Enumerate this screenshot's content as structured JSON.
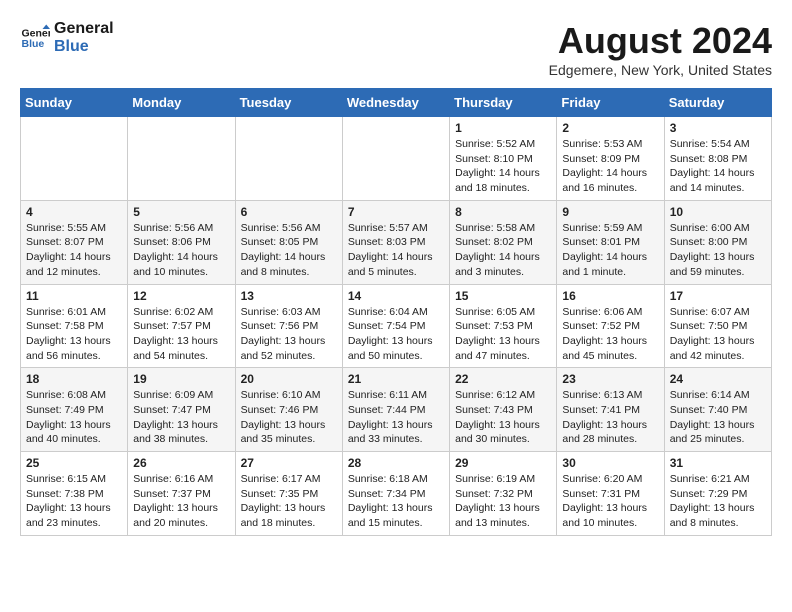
{
  "header": {
    "logo_line1": "General",
    "logo_line2": "Blue",
    "month_year": "August 2024",
    "location": "Edgemere, New York, United States"
  },
  "weekdays": [
    "Sunday",
    "Monday",
    "Tuesday",
    "Wednesday",
    "Thursday",
    "Friday",
    "Saturday"
  ],
  "weeks": [
    [
      {
        "day": "",
        "info": ""
      },
      {
        "day": "",
        "info": ""
      },
      {
        "day": "",
        "info": ""
      },
      {
        "day": "",
        "info": ""
      },
      {
        "day": "1",
        "info": "Sunrise: 5:52 AM\nSunset: 8:10 PM\nDaylight: 14 hours\nand 18 minutes."
      },
      {
        "day": "2",
        "info": "Sunrise: 5:53 AM\nSunset: 8:09 PM\nDaylight: 14 hours\nand 16 minutes."
      },
      {
        "day": "3",
        "info": "Sunrise: 5:54 AM\nSunset: 8:08 PM\nDaylight: 14 hours\nand 14 minutes."
      }
    ],
    [
      {
        "day": "4",
        "info": "Sunrise: 5:55 AM\nSunset: 8:07 PM\nDaylight: 14 hours\nand 12 minutes."
      },
      {
        "day": "5",
        "info": "Sunrise: 5:56 AM\nSunset: 8:06 PM\nDaylight: 14 hours\nand 10 minutes."
      },
      {
        "day": "6",
        "info": "Sunrise: 5:56 AM\nSunset: 8:05 PM\nDaylight: 14 hours\nand 8 minutes."
      },
      {
        "day": "7",
        "info": "Sunrise: 5:57 AM\nSunset: 8:03 PM\nDaylight: 14 hours\nand 5 minutes."
      },
      {
        "day": "8",
        "info": "Sunrise: 5:58 AM\nSunset: 8:02 PM\nDaylight: 14 hours\nand 3 minutes."
      },
      {
        "day": "9",
        "info": "Sunrise: 5:59 AM\nSunset: 8:01 PM\nDaylight: 14 hours\nand 1 minute."
      },
      {
        "day": "10",
        "info": "Sunrise: 6:00 AM\nSunset: 8:00 PM\nDaylight: 13 hours\nand 59 minutes."
      }
    ],
    [
      {
        "day": "11",
        "info": "Sunrise: 6:01 AM\nSunset: 7:58 PM\nDaylight: 13 hours\nand 56 minutes."
      },
      {
        "day": "12",
        "info": "Sunrise: 6:02 AM\nSunset: 7:57 PM\nDaylight: 13 hours\nand 54 minutes."
      },
      {
        "day": "13",
        "info": "Sunrise: 6:03 AM\nSunset: 7:56 PM\nDaylight: 13 hours\nand 52 minutes."
      },
      {
        "day": "14",
        "info": "Sunrise: 6:04 AM\nSunset: 7:54 PM\nDaylight: 13 hours\nand 50 minutes."
      },
      {
        "day": "15",
        "info": "Sunrise: 6:05 AM\nSunset: 7:53 PM\nDaylight: 13 hours\nand 47 minutes."
      },
      {
        "day": "16",
        "info": "Sunrise: 6:06 AM\nSunset: 7:52 PM\nDaylight: 13 hours\nand 45 minutes."
      },
      {
        "day": "17",
        "info": "Sunrise: 6:07 AM\nSunset: 7:50 PM\nDaylight: 13 hours\nand 42 minutes."
      }
    ],
    [
      {
        "day": "18",
        "info": "Sunrise: 6:08 AM\nSunset: 7:49 PM\nDaylight: 13 hours\nand 40 minutes."
      },
      {
        "day": "19",
        "info": "Sunrise: 6:09 AM\nSunset: 7:47 PM\nDaylight: 13 hours\nand 38 minutes."
      },
      {
        "day": "20",
        "info": "Sunrise: 6:10 AM\nSunset: 7:46 PM\nDaylight: 13 hours\nand 35 minutes."
      },
      {
        "day": "21",
        "info": "Sunrise: 6:11 AM\nSunset: 7:44 PM\nDaylight: 13 hours\nand 33 minutes."
      },
      {
        "day": "22",
        "info": "Sunrise: 6:12 AM\nSunset: 7:43 PM\nDaylight: 13 hours\nand 30 minutes."
      },
      {
        "day": "23",
        "info": "Sunrise: 6:13 AM\nSunset: 7:41 PM\nDaylight: 13 hours\nand 28 minutes."
      },
      {
        "day": "24",
        "info": "Sunrise: 6:14 AM\nSunset: 7:40 PM\nDaylight: 13 hours\nand 25 minutes."
      }
    ],
    [
      {
        "day": "25",
        "info": "Sunrise: 6:15 AM\nSunset: 7:38 PM\nDaylight: 13 hours\nand 23 minutes."
      },
      {
        "day": "26",
        "info": "Sunrise: 6:16 AM\nSunset: 7:37 PM\nDaylight: 13 hours\nand 20 minutes."
      },
      {
        "day": "27",
        "info": "Sunrise: 6:17 AM\nSunset: 7:35 PM\nDaylight: 13 hours\nand 18 minutes."
      },
      {
        "day": "28",
        "info": "Sunrise: 6:18 AM\nSunset: 7:34 PM\nDaylight: 13 hours\nand 15 minutes."
      },
      {
        "day": "29",
        "info": "Sunrise: 6:19 AM\nSunset: 7:32 PM\nDaylight: 13 hours\nand 13 minutes."
      },
      {
        "day": "30",
        "info": "Sunrise: 6:20 AM\nSunset: 7:31 PM\nDaylight: 13 hours\nand 10 minutes."
      },
      {
        "day": "31",
        "info": "Sunrise: 6:21 AM\nSunset: 7:29 PM\nDaylight: 13 hours\nand 8 minutes."
      }
    ]
  ]
}
